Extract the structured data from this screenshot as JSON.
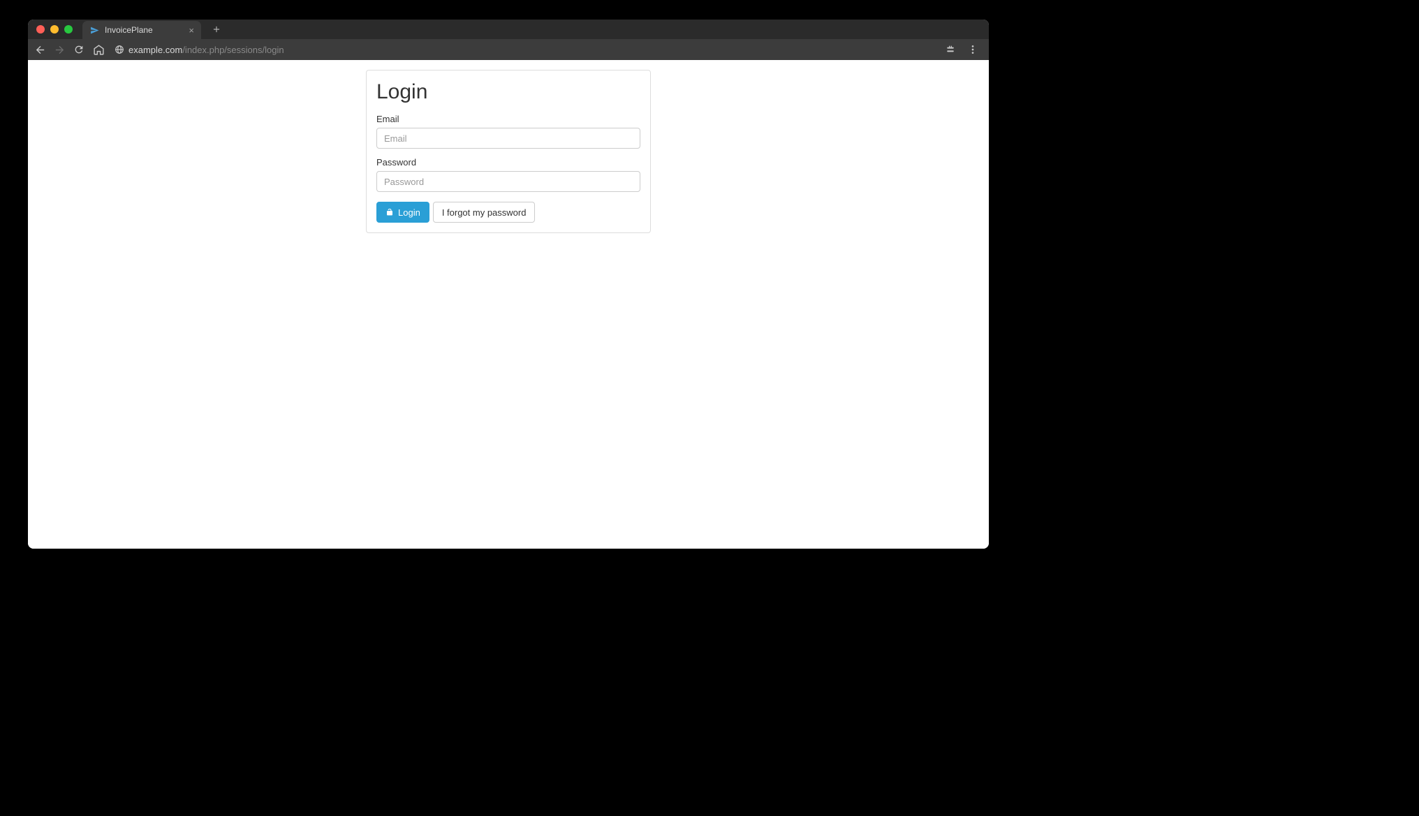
{
  "browser": {
    "tab_title": "InvoicePlane",
    "url_domain": "example.com",
    "url_path": "/index.php/sessions/login"
  },
  "login": {
    "title": "Login",
    "email_label": "Email",
    "email_placeholder": "Email",
    "password_label": "Password",
    "password_placeholder": "Password",
    "login_button": "Login",
    "forgot_button": "I forgot my password"
  }
}
